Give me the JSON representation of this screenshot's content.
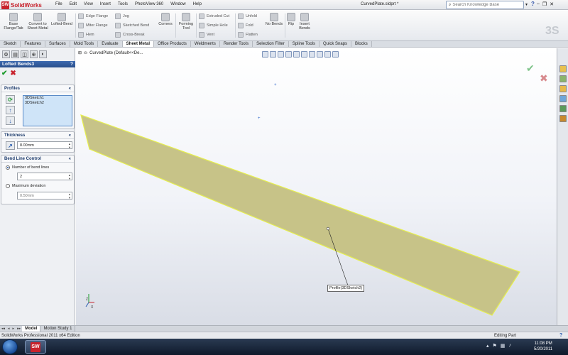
{
  "app": {
    "logo_text": "SolidWorks",
    "menus": [
      "File",
      "Edit",
      "View",
      "Insert",
      "Tools",
      "PhotoView 360",
      "Window",
      "Help"
    ],
    "document_title": "CurvedPlate.sldprt *",
    "search_placeholder": "Search Knowledge Base"
  },
  "command_manager": {
    "big_tools": [
      {
        "label": "Base Flange/Tab",
        "icon": "base-flange-icon"
      },
      {
        "label": "Convert to Sheet Metal",
        "icon": "convert-sheet-metal-icon"
      },
      {
        "label": "Lofted-Bend",
        "icon": "lofted-bend-icon"
      }
    ],
    "small_col1": [
      "Edge Flange",
      "Miter Flange",
      "Hem"
    ],
    "small_col2": [
      "Jog",
      "Sketched Bend",
      "Cross-Break"
    ],
    "corners_label": "Corners",
    "forming_tool_label": "Forming Tool",
    "small_col3": [
      "Extruded Cut",
      "Simple Hole",
      "Vent"
    ],
    "small_col4": [
      "Unfold",
      "Fold",
      "Flatten"
    ],
    "no_bends_label": "No Bends",
    "rip_label": "Rip",
    "insert_bends_label": "Insert Bends"
  },
  "tabs": [
    "Sketch",
    "Features",
    "Surfaces",
    "Mold Tools",
    "Evaluate",
    "Sheet Metal",
    "Office Products",
    "Weldments",
    "Render Tools",
    "Selection Filter",
    "Spline Tools",
    "Quick Snaps",
    "Blocks"
  ],
  "active_tab": "Sheet Metal",
  "property_manager": {
    "title": "Lofted Bends3",
    "profiles": {
      "header": "Profiles",
      "items": [
        "3DSketch1",
        "3DSketch2"
      ]
    },
    "thickness": {
      "header": "Thickness",
      "value": "8.00mm"
    },
    "bend_line_control": {
      "header": "Bend Line Control",
      "option1": "Number of bend lines",
      "bend_lines_value": "2",
      "option2": "Maximum deviation",
      "deviation_value": "0.50mm",
      "selected": "Number of bend lines"
    }
  },
  "viewport": {
    "tree_label": "CurvedPlate  (Default<<De...",
    "profile_callout": "Profile(3DSketch2)",
    "part_color": "#c7c388",
    "edge_color": "#e6ef4f"
  },
  "bottom_tabs": [
    "Model",
    "Motion Study 1"
  ],
  "active_bottom_tab": "Model",
  "status": {
    "left": "SolidWorks Professional 2011 x64 Edition",
    "right": "Editing Part",
    "help": "?"
  },
  "taskbar": {
    "time": "11:08 PM",
    "date": "5/20/2011"
  }
}
